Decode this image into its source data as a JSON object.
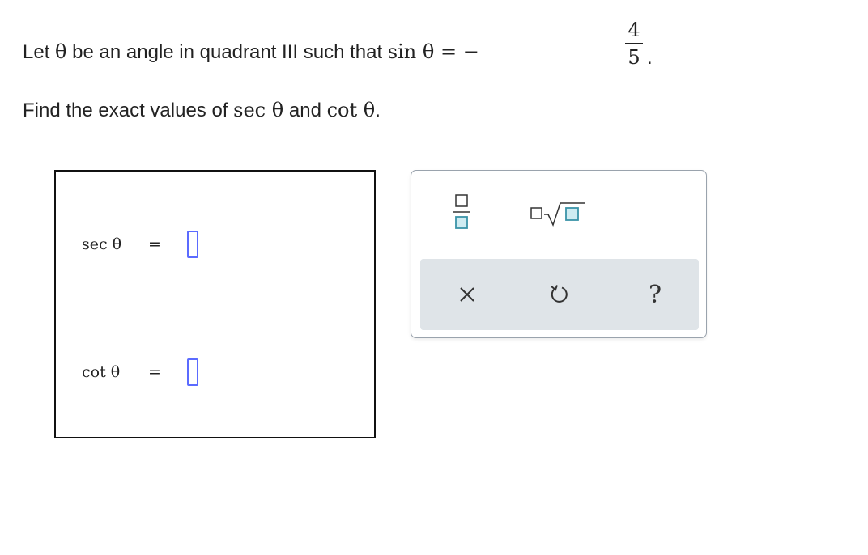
{
  "problem": {
    "line1_prefix": "Let",
    "theta": "θ",
    "line1_mid": "be an angle in quadrant III such that",
    "sin_expr": "sin θ = −",
    "numerator": "4",
    "denominator": "5",
    "period": ".",
    "line2_prefix": "Find the exact values of",
    "sec_expr": "sec θ",
    "and": "and",
    "cot_expr": "cot θ",
    "line2_end": "."
  },
  "answers": [
    {
      "label": "sec θ",
      "equals": "=",
      "value": ""
    },
    {
      "label": "cot θ",
      "equals": "=",
      "value": ""
    }
  ],
  "keypad": {
    "buttons": [
      "fraction-button",
      "sqrt-button",
      "clear-button",
      "undo-button",
      "help-button"
    ],
    "help_symbol": "?",
    "accent_color": "#5bb8c8",
    "slot_color": "#5b6bff"
  }
}
